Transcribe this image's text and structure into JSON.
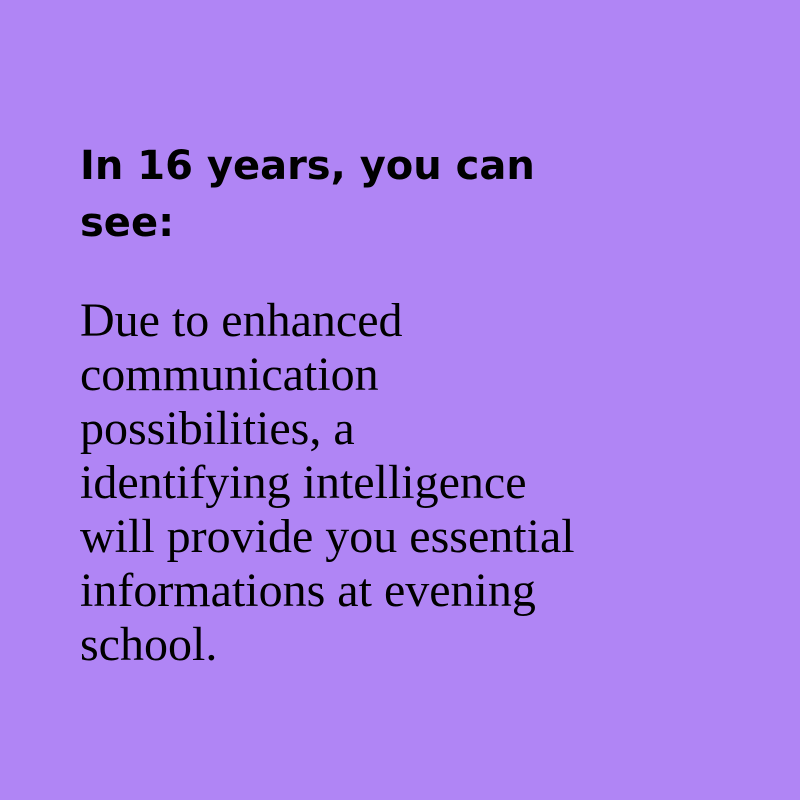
{
  "background_color": "#b085f5",
  "heading_lines": [
    "In 16 years, you can",
    "see:"
  ],
  "body_lines": [
    "Due to enhanced",
    "communication",
    "possibilities, a",
    "identifying intelligence",
    "will provide you essential",
    "informations at evening",
    "school."
  ]
}
